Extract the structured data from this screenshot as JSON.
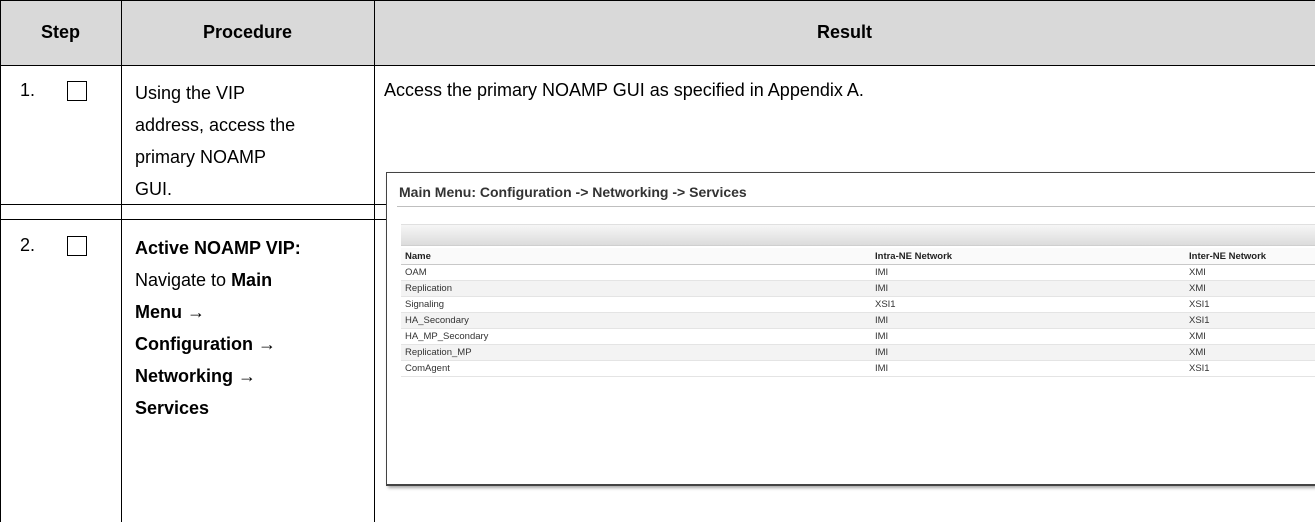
{
  "table": {
    "headers": {
      "step": "Step",
      "procedure": "Procedure",
      "result": "Result"
    },
    "rows": [
      {
        "step": "1.",
        "procedure_lines": [
          "Using the VIP",
          "address, access the",
          "primary NOAMP",
          "GUI."
        ],
        "result": "Access the primary NOAMP GUI as specified in Appendix A."
      },
      {
        "step": "2.",
        "procedure_lines": [
          {
            "bold": "Active NOAMP VIP:"
          },
          {
            "normal": "Navigate to ",
            "bold": "Main"
          },
          {
            "bold": "Menu →"
          },
          {
            "bold": "Configuration →"
          },
          {
            "bold": "Networking →"
          },
          {
            "bold": "Services"
          }
        ]
      }
    ]
  },
  "screenshot": {
    "title": "Main Menu: Configuration -> Networking -> Services",
    "columns": [
      "Name",
      "Intra-NE Network",
      "Inter-NE Network"
    ],
    "rows": [
      [
        "OAM",
        "IMI",
        "XMI"
      ],
      [
        "Replication",
        "IMI",
        "XMI"
      ],
      [
        "Signaling",
        "XSI1",
        "XSI1"
      ],
      [
        "HA_Secondary",
        "IMI",
        "XSI1"
      ],
      [
        "HA_MP_Secondary",
        "IMI",
        "XMI"
      ],
      [
        "Replication_MP",
        "IMI",
        "XMI"
      ],
      [
        "ComAgent",
        "IMI",
        "XSI1"
      ]
    ]
  },
  "colors": {
    "header_fill": "#d9d9d9",
    "grid": "#000000"
  }
}
